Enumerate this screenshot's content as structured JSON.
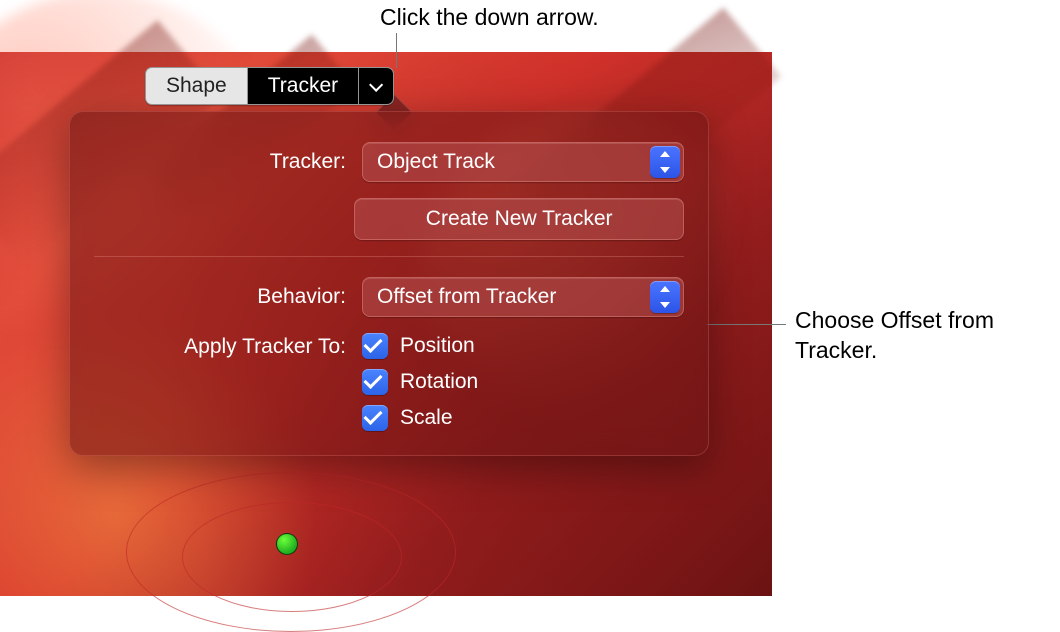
{
  "toolbar": {
    "segments": {
      "shape": "Shape",
      "tracker": "Tracker"
    }
  },
  "popover": {
    "tracker_label": "Tracker:",
    "tracker_value": "Object Track",
    "create_button": "Create New Tracker",
    "behavior_label": "Behavior:",
    "behavior_value": "Offset from Tracker",
    "apply_label": "Apply Tracker To:",
    "checks": {
      "position": "Position",
      "rotation": "Rotation",
      "scale": "Scale"
    }
  },
  "callouts": {
    "top": "Click the down arrow.",
    "right": "Choose Offset from Tracker."
  }
}
